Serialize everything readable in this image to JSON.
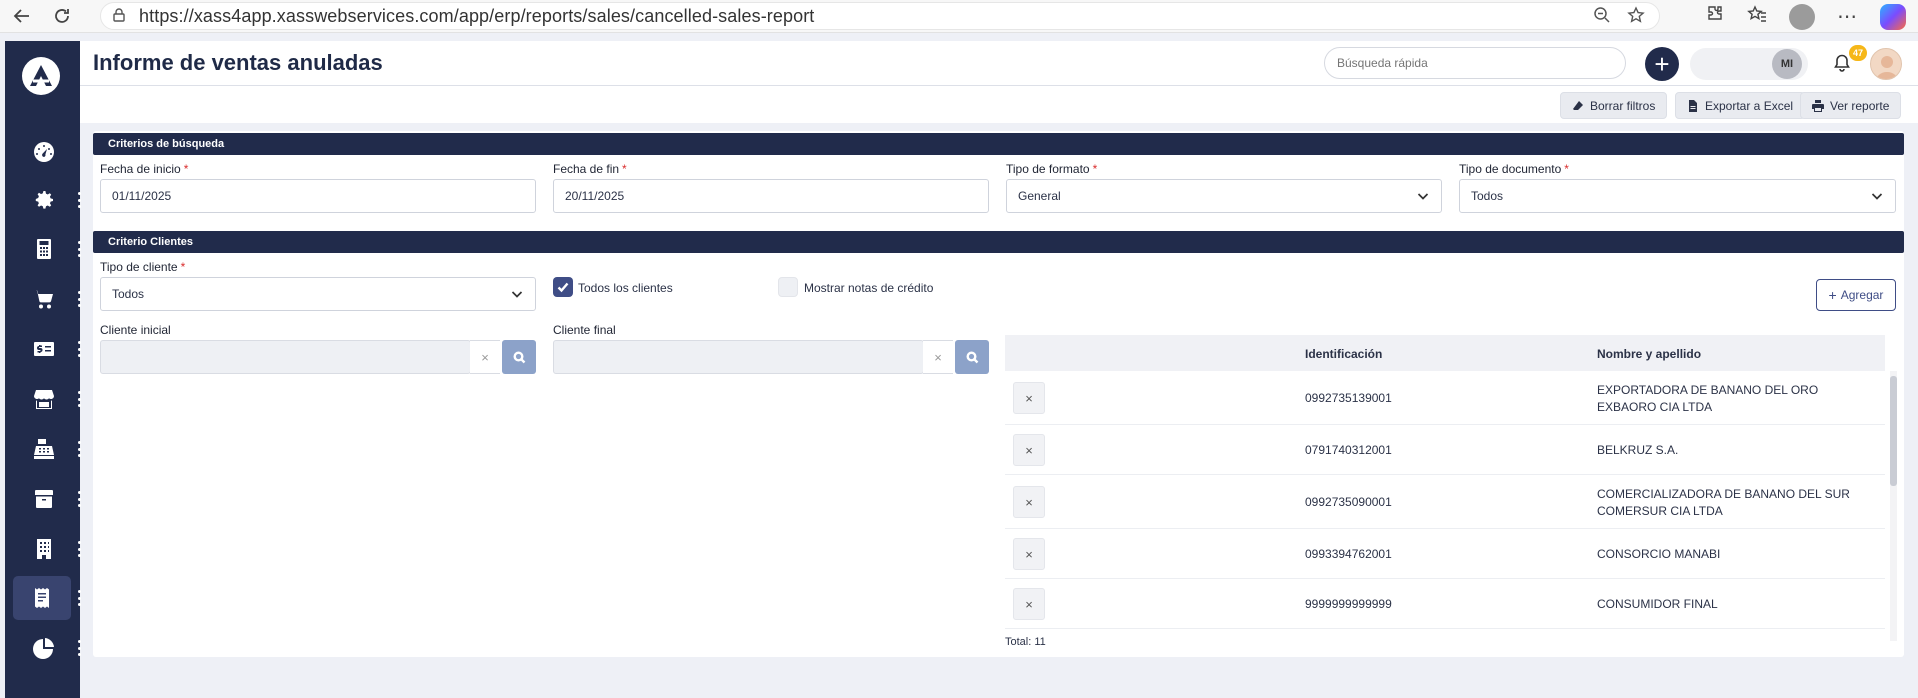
{
  "browser": {
    "url": "https://xass4app.xasswebservices.com/app/erp/reports/sales/cancelled-sales-report"
  },
  "header": {
    "title": "Informe de ventas anuladas",
    "search_placeholder": "Búsqueda rápida",
    "user_initials": "MI",
    "notification_count": "47"
  },
  "toolbar": {
    "clear_filters": "Borrar filtros",
    "export_excel": "Exportar a Excel",
    "view_report": "Ver reporte"
  },
  "search_criteria": {
    "section_title": "Criterios de búsqueda",
    "start_date_label": "Fecha de inicio",
    "start_date_value": "01/11/2025",
    "end_date_label": "Fecha de fin",
    "end_date_value": "20/11/2025",
    "format_type_label": "Tipo de formato",
    "format_type_value": "General",
    "document_type_label": "Tipo de documento",
    "document_type_value": "Todos",
    "required_mark": "*"
  },
  "client_criteria": {
    "section_title": "Criterio Clientes",
    "client_type_label": "Tipo de cliente",
    "client_type_value": "Todos",
    "all_clients_label": "Todos los clientes",
    "all_clients_checked": true,
    "show_credit_notes_label": "Mostrar notas de crédito",
    "show_credit_notes_checked": false,
    "add_button": "Agregar",
    "initial_client_label": "Cliente inicial",
    "final_client_label": "Cliente final",
    "clear_glyph": "×"
  },
  "clients_table": {
    "columns": [
      "Identificación",
      "Nombre y apellido"
    ],
    "rows": [
      {
        "id": "0992735139001",
        "name": "EXPORTADORA DE BANANO DEL ORO EXBAORO CIA LTDA"
      },
      {
        "id": "0791740312001",
        "name": "BELKRUZ S.A."
      },
      {
        "id": "0992735090001",
        "name": "COMERCIALIZADORA DE BANANO DEL SUR COMERSUR CIA LTDA"
      },
      {
        "id": "0993394762001",
        "name": "CONSORCIO MANABI"
      },
      {
        "id": "9999999999999",
        "name": "CONSUMIDOR FINAL"
      }
    ],
    "total_label": "Total: 11",
    "remove_glyph": "×"
  },
  "sidebar": {
    "logo": "Λ",
    "items": [
      {
        "icon": "dashboard-icon"
      },
      {
        "icon": "gear-icon"
      },
      {
        "icon": "calculator-icon"
      },
      {
        "icon": "cart-icon"
      },
      {
        "icon": "money-card-icon"
      },
      {
        "icon": "store-icon"
      },
      {
        "icon": "cash-register-icon"
      },
      {
        "icon": "box-icon"
      },
      {
        "icon": "building-icon"
      },
      {
        "icon": "receipt-icon",
        "active": true
      },
      {
        "icon": "pie-chart-icon"
      }
    ]
  },
  "colors": {
    "sidebar": "#212b4b",
    "accent": "#3f4d86",
    "required": "#d92d2d",
    "badge": "#f6b718"
  }
}
